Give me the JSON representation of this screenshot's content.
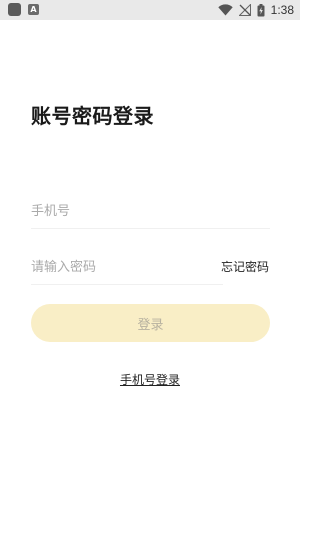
{
  "status_bar": {
    "time": "1:38",
    "notification_badge": "A",
    "icons": [
      "app-notification-icon",
      "a-badge-icon",
      "wifi-icon",
      "no-signal-icon",
      "battery-charging-icon"
    ]
  },
  "login": {
    "title": "账号密码登录",
    "phone_placeholder": "手机号",
    "phone_value": "",
    "password_placeholder": "请输入密码",
    "password_value": "",
    "forgot_password": "忘记密码",
    "login_button": "登录",
    "phone_login_link": "手机号登录"
  },
  "colors": {
    "button_background": "#f9eec6",
    "button_text": "#b7b1a0",
    "status_bar": "#e9e9e9"
  }
}
